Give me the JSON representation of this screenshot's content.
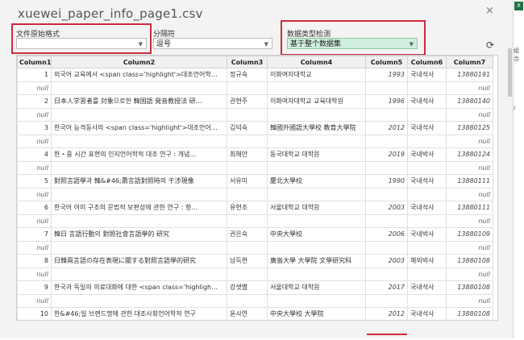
{
  "window": {
    "title": "xuewei_paper_info_page1.csv",
    "close_glyph": "×"
  },
  "controls": {
    "origin_format": {
      "label": "文件原始格式",
      "value": ""
    },
    "delimiter": {
      "label": "分隔符",
      "value": "逗号"
    },
    "type_detection": {
      "label": "数据类型检测",
      "value": "基于整个数据集"
    }
  },
  "table": {
    "headers": [
      "Column1",
      "Column2",
      "Column3",
      "Column4",
      "Column5",
      "Column6",
      "Column7"
    ],
    "rows": [
      [
        "1",
        "외국어 교육에서 <span class='highlight'>대조언어학…",
        "정규숙",
        "이화여자대학교",
        "1993",
        "국내석사",
        "13880191"
      ],
      [
        "null",
        "",
        "",
        "",
        "",
        "",
        "null"
      ],
      [
        "2",
        "日本人学習者를 対象으로한 韓国語 発音教授法 研…",
        "권현주",
        "이화여자대학교 교육대학원",
        "1996",
        "국내석사",
        "13880140"
      ],
      [
        "null",
        "",
        "",
        "",
        "",
        "",
        "null"
      ],
      [
        "3",
        "한국어 능격동사의 <span class='highlight'>대조언어…",
        "김덕숙",
        "韓國外國語大學校 教育大學院",
        "2012",
        "국내석사",
        "13880125"
      ],
      [
        "null",
        "",
        "",
        "",
        "",
        "",
        "null"
      ],
      [
        "4",
        "한・중 시간 표현의 인지언어학적 대조 연구 : 개념…",
        "최해만",
        "동국대학교 대학원",
        "2019",
        "국내박사",
        "13880124"
      ],
      [
        "null",
        "",
        "",
        "",
        "",
        "",
        "null"
      ],
      [
        "5",
        "對照言語學과 韓&#46;蕭言語對照時의 干涉現像",
        "서유미",
        "慶北大學校",
        "1990",
        "국내석사",
        "13880111"
      ],
      [
        "null",
        "",
        "",
        "",
        "",
        "",
        "null"
      ],
      [
        "6",
        "한국어 어미 구조의 문법적 보편성에 관한 연구 : 형…",
        "유현조",
        "서울대학교 대학원",
        "2003",
        "국내석사",
        "13880111"
      ],
      [
        "null",
        "",
        "",
        "",
        "",
        "",
        "null"
      ],
      [
        "7",
        "韓日 言語行動의 對照社會言語學的 研究",
        "권은숙",
        "中央大學校",
        "2006",
        "국내박사",
        "13880109"
      ],
      [
        "null",
        "",
        "",
        "",
        "",
        "",
        "null"
      ],
      [
        "8",
        "日韓兩言語の存在表現に關する對照言語學的研究",
        "남득현",
        "廣島大學 大學院 文學研究科",
        "2003",
        "해외박사",
        "13880108"
      ],
      [
        "null",
        "",
        "",
        "",
        "",
        "",
        "null"
      ],
      [
        "9",
        "한국과 독일의 의료대화에 대한 <span class='highligh…",
        "강샛별",
        "서울대학교 대학원",
        "2017",
        "국내석사",
        "13880108"
      ],
      [
        "null",
        "",
        "",
        "",
        "",
        "",
        "null"
      ],
      [
        "10",
        "한&#46;일 브랜드명에 관한 대조사회언어학적 연구",
        "윤사연",
        "中央大學校 大學院",
        "2012",
        "국내석사",
        "13880108"
      ]
    ]
  },
  "sheet_side": {
    "icon": "X",
    "snippets": [
      "组合",
      "/"
    ]
  }
}
